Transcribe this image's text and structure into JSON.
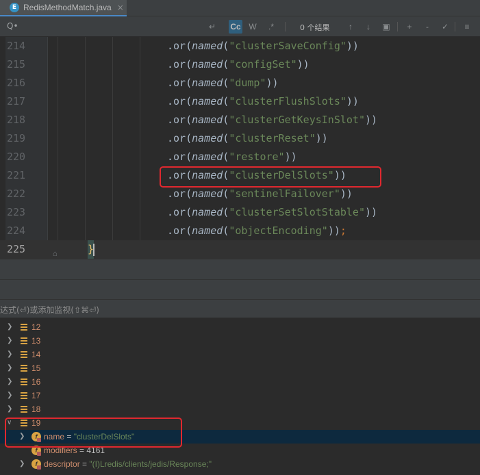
{
  "tab": {
    "icon_letter": "E",
    "filename": "RedisMethodMatch.java",
    "close": "×"
  },
  "search": {
    "search_icon": "Q•",
    "btn_regex_newline": "↵",
    "btn_case": "Cc",
    "btn_words": "W",
    "btn_regex": ".*",
    "result_count": "0 个结果",
    "up_icon": "↑",
    "down_icon": "↓",
    "select_all_icon": "▣",
    "add_caret_icon": "+",
    "remove_caret_icon": "-",
    "toggle_icon": "✓",
    "filter_icon": "≡"
  },
  "editor": {
    "lines": [
      {
        "num": "214",
        "pre": ".or(",
        "method": "named",
        "open": "(",
        "str": "\"clusterSaveConfig\"",
        "post": "))"
      },
      {
        "num": "215",
        "pre": ".or(",
        "method": "named",
        "open": "(",
        "str": "\"configSet\"",
        "post": "))"
      },
      {
        "num": "216",
        "pre": ".or(",
        "method": "named",
        "open": "(",
        "str": "\"dump\"",
        "post": "))"
      },
      {
        "num": "217",
        "pre": ".or(",
        "method": "named",
        "open": "(",
        "str": "\"clusterFlushSlots\"",
        "post": "))"
      },
      {
        "num": "218",
        "pre": ".or(",
        "method": "named",
        "open": "(",
        "str": "\"clusterGetKeysInSlot\"",
        "post": "))"
      },
      {
        "num": "219",
        "pre": ".or(",
        "method": "named",
        "open": "(",
        "str": "\"clusterReset\"",
        "post": "))"
      },
      {
        "num": "220",
        "pre": ".or(",
        "method": "named",
        "open": "(",
        "str": "\"restore\"",
        "post": "))"
      },
      {
        "num": "221",
        "pre": ".or(",
        "method": "named",
        "open": "(",
        "str": "\"clusterDelSlots\"",
        "post": "))"
      },
      {
        "num": "222",
        "pre": ".or(",
        "method": "named",
        "open": "(",
        "str": "\"sentinelFailover\"",
        "post": "))"
      },
      {
        "num": "223",
        "pre": ".or(",
        "method": "named",
        "open": "(",
        "str": "\"clusterSetSlotStable\"",
        "post": "))"
      },
      {
        "num": "224",
        "pre": ".or(",
        "method": "named",
        "open": "(",
        "str": "\"objectEncoding\"",
        "post": "))",
        "semi": ";"
      }
    ],
    "last_line_num": "225",
    "closing_brace": "}"
  },
  "watch": {
    "hint": "达式(⏎)或添加监视(⇧⌘⏎)"
  },
  "variables": {
    "indices": [
      "12",
      "13",
      "14",
      "15",
      "16",
      "17",
      "18",
      "19"
    ],
    "fields": [
      {
        "name": "name",
        "eq": " = ",
        "value": "\"clusterDelSlots\"",
        "kind": "str"
      },
      {
        "name": "modifiers",
        "eq": " = ",
        "value": "4161",
        "kind": "num"
      },
      {
        "name": "descriptor",
        "eq": " = ",
        "value": "\"(I)Lredis/clients/jedis/Response;\"",
        "kind": "str"
      }
    ]
  },
  "colors": {
    "highlight": "#e0282f",
    "selected_row": "#0d293e",
    "string": "#6a8759"
  }
}
